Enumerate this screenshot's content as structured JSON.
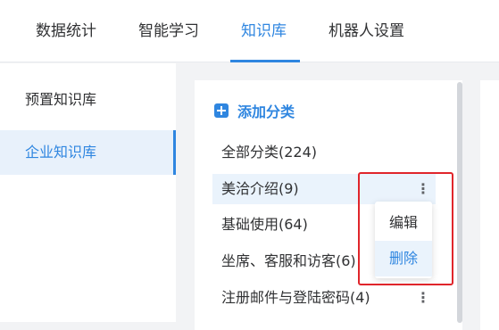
{
  "header": {
    "tabs": [
      {
        "label": "数据统计"
      },
      {
        "label": "智能学习"
      },
      {
        "label": "知识库"
      },
      {
        "label": "机器人设置"
      }
    ]
  },
  "sidebar": {
    "items": [
      {
        "label": "预置知识库"
      },
      {
        "label": "企业知识库"
      }
    ]
  },
  "categories": {
    "add_label": "添加分类",
    "items": [
      {
        "label": "全部分类(224)"
      },
      {
        "label": "美洽介绍(9)"
      },
      {
        "label": "基础使用(64)"
      },
      {
        "label": "坐席、客服和访客(6)"
      },
      {
        "label": "注册邮件与登陆密码(4)"
      }
    ]
  },
  "context_menu": {
    "edit_label": "编辑",
    "delete_label": "删除"
  },
  "icons": {
    "more": "⋮"
  },
  "colors": {
    "accent": "#2f86e0",
    "highlight": "#e0252b"
  }
}
